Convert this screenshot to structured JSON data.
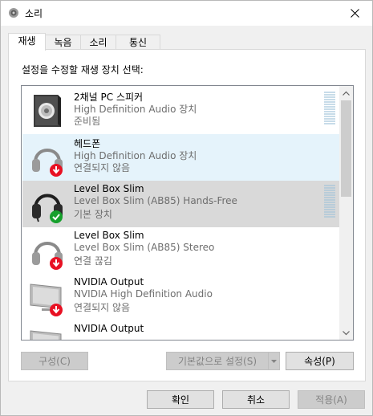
{
  "window": {
    "title": "소리",
    "icon": "speaker-icon"
  },
  "tabs": [
    {
      "label": "재생",
      "active": true
    },
    {
      "label": "녹음",
      "active": false
    },
    {
      "label": "소리",
      "active": false
    },
    {
      "label": "통신",
      "active": false
    }
  ],
  "panel": {
    "instruction": "설정을 수정할 재생 장치 선택:"
  },
  "devices": [
    {
      "name": "2채널 PC 스피커",
      "description": "High Definition Audio 장치",
      "status": "준비됨",
      "icon": "speaker-device-icon",
      "badge": "",
      "state": "normal"
    },
    {
      "name": "헤드폰",
      "description": "High Definition Audio 장치",
      "status": "연결되지 않음",
      "icon": "headphones-icon",
      "badge": "disconnected-badge-icon",
      "state": "hover"
    },
    {
      "name": "Level Box Slim",
      "description": "Level Box Slim (AB85) Hands-Free",
      "status": "기본 장치",
      "icon": "headset-icon",
      "badge": "default-check-badge-icon",
      "state": "selected"
    },
    {
      "name": "Level Box Slim",
      "description": "Level Box Slim (AB85) Stereo",
      "status": "연결 끊김",
      "icon": "headphones-icon",
      "badge": "disconnected-badge-icon",
      "state": "normal"
    },
    {
      "name": "NVIDIA Output",
      "description": "NVIDIA High Definition Audio",
      "status": "연결되지 않음",
      "icon": "monitor-icon",
      "badge": "disconnected-badge-icon",
      "state": "normal"
    },
    {
      "name": "NVIDIA Output",
      "description": "",
      "status": "",
      "icon": "monitor-icon",
      "badge": "",
      "state": "normal"
    }
  ],
  "panel_buttons": {
    "configure": "구성(C)",
    "set_default": "기본값으로 설정(S)",
    "properties": "속성(P)"
  },
  "dialog_buttons": {
    "ok": "확인",
    "cancel": "취소",
    "apply": "적용(A)"
  },
  "colors": {
    "accent": "#0078d7",
    "selected_row": "#d9d9d9",
    "hover_row": "#e5f3fb",
    "disconnected": "#e81123",
    "default_ok": "#16a02c"
  }
}
